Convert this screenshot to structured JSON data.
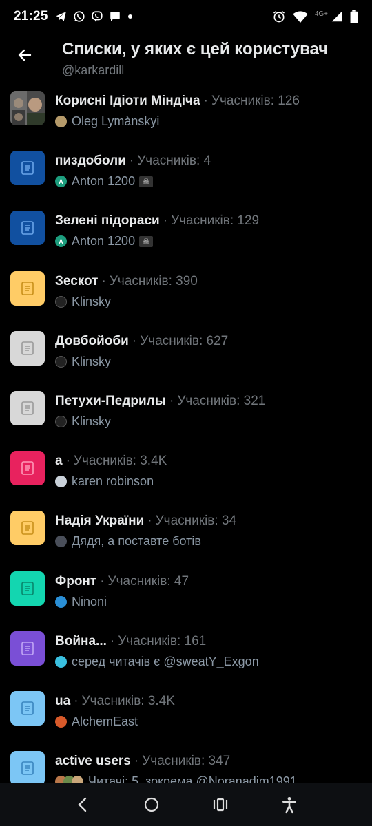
{
  "status_bar": {
    "time": "21:25",
    "network": "4G+"
  },
  "header": {
    "title": "Списки, у яких є цей користувач",
    "subtitle": "@karkardill"
  },
  "lists": [
    {
      "name": "Корисні Ідіоти Міндіча",
      "members": "Учасників: 126",
      "owner": "Oleg Lymànskyi",
      "icon_color": "#3a3a3a",
      "owner_avatar_color": "#b59a6a",
      "photo": true
    },
    {
      "name": "пиздоболи",
      "members": "Учасників: 4",
      "owner": "Anton 1200",
      "icon_color": "#1150a0",
      "owner_avatar_color": "#1d9e7e",
      "owner_initial": "A",
      "badge": "☠"
    },
    {
      "name": "Зелені підораси",
      "members": "Учасників: 129",
      "owner": "Anton 1200",
      "icon_color": "#1150a0",
      "owner_avatar_color": "#1d9e7e",
      "owner_initial": "A",
      "badge": "☠"
    },
    {
      "name": "Зескот",
      "members": "Учасників: 390",
      "owner": "Klinsky",
      "icon_color": "#ffcc66",
      "owner_avatar_color": "#222"
    },
    {
      "name": "Довбойоби",
      "members": "Учасників: 627",
      "owner": "Klinsky",
      "icon_color": "#d8d8d8",
      "owner_avatar_color": "#222"
    },
    {
      "name": "Петухи-Педрилы",
      "members": "Учасників: 321",
      "owner": "Klinsky",
      "icon_color": "#d8d8d8",
      "owner_avatar_color": "#222"
    },
    {
      "name": "a",
      "members": "Учасників: 3.4K",
      "owner": "karen robinson",
      "icon_color": "#e8225e",
      "owner_avatar_color": "#c9d1d9"
    },
    {
      "name": "Надія України",
      "members": "Учасників: 34",
      "owner": "Дядя, а поставте ботів",
      "icon_color": "#ffcc66",
      "owner_avatar_color": "#4a4f5a"
    },
    {
      "name": "Фронт",
      "members": "Учасників: 47",
      "owner": "Ninoni",
      "icon_color": "#13d6b0",
      "owner_avatar_color": "#2a8fd6"
    },
    {
      "name": "Война...",
      "members": "Учасників: 161",
      "owner": "серед читачів є @sweatY_Exgon",
      "icon_color": "#7a4fd6",
      "owner_avatar_color": "#3ac0e0"
    },
    {
      "name": "ua",
      "members": "Учасників: 3.4K",
      "owner": "AlchemEast",
      "icon_color": "#7cc6f5",
      "owner_avatar_color": "#d85a2a"
    },
    {
      "name": "active users",
      "members": "Учасників: 347",
      "owner": "Читачі: 5, зокрема @Noranadim1991",
      "icon_color": "#7cc6f5",
      "owner_avatar_color": "#b9774a"
    }
  ],
  "colors": {
    "background": "#000000",
    "text_primary": "#e7e9ea",
    "text_secondary": "#71767b"
  }
}
